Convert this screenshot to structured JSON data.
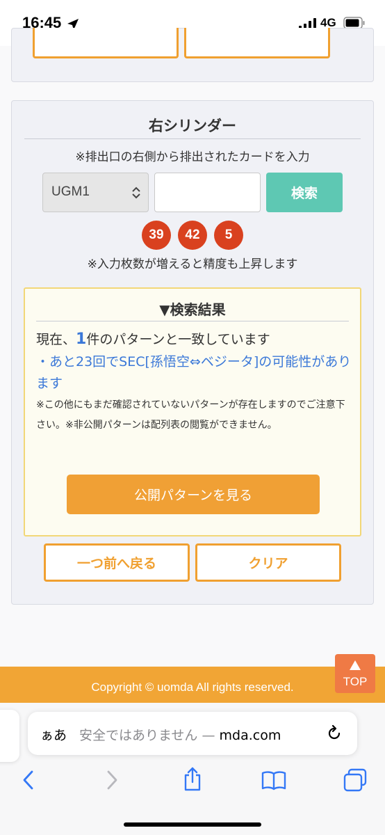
{
  "status_bar": {
    "time": "16:45",
    "network": "4G"
  },
  "panel": {
    "title": "右シリンダー",
    "description": "※排出口の右側から排出されたカードを入力",
    "select": {
      "value": "UGM1"
    },
    "input": {
      "value": "",
      "placeholder": ""
    },
    "search_label": "検索",
    "chips": [
      "39",
      "42",
      "5"
    ],
    "accuracy_note": "※入力枚数が増えると精度も上昇します"
  },
  "result": {
    "title": "▼検索結果",
    "match_prefix": "現在、",
    "match_count": "1",
    "match_suffix": "件のパターンと一致しています",
    "sec_text": "・あと23回でSEC[孫悟空⇔ベジータ]の可能性があります",
    "caution": "※この他にもまだ確認されていないパターンが存在しますのでご注意下さい。※非公開パターンは配列表の閲覧ができません。",
    "public_button": "公開パターンを見る"
  },
  "buttons": {
    "back": "一つ前へ戻る",
    "clear": "クリア"
  },
  "footer": {
    "copyright": "Copyright © uomda All rights reserved.",
    "top_label": "TOP"
  },
  "browser": {
    "aa": "ぁあ",
    "url_prefix": "安全ではありません — ",
    "url_domain": "mda.com"
  },
  "colors": {
    "accent_orange": "#f0a030",
    "search_teal": "#5ec8b3",
    "chip_red": "#d9411f",
    "link_blue": "#3b78d8"
  },
  "icons": [
    "location-arrow-icon",
    "signal-icon",
    "battery-icon",
    "chevron-up-down-icon",
    "arrow-up-icon",
    "reload-icon",
    "back-icon",
    "forward-icon",
    "share-icon",
    "bookmarks-icon",
    "tabs-icon"
  ]
}
